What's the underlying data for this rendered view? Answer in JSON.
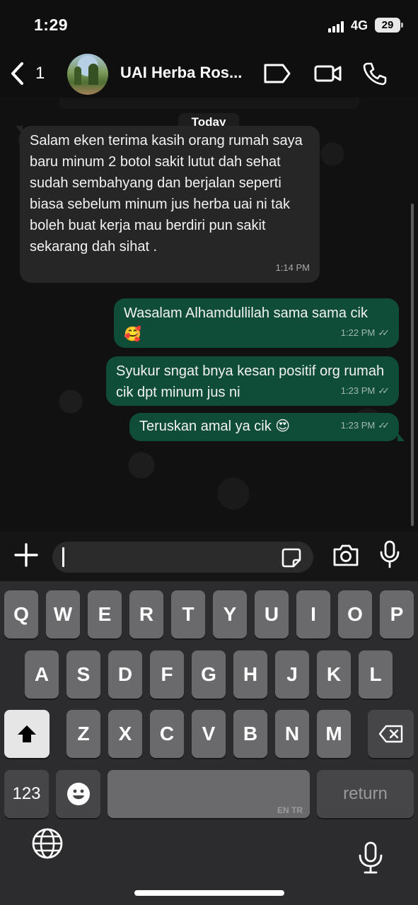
{
  "status_bar": {
    "time": "1:29",
    "network": "4G",
    "battery": "29"
  },
  "header": {
    "back_count": "1",
    "chat_name": "UAI Herba Ros...",
    "icons": [
      "chevron-left-icon",
      "tag-icon",
      "video-call-icon",
      "phone-icon"
    ]
  },
  "chat": {
    "date_label": "Today",
    "messages": [
      {
        "direction": "incoming",
        "text": "Salam eken terima kasih orang rumah saya baru minum 2 botol sakit lutut dah sehat sudah sembahyang dan berjalan seperti biasa sebelum minum jus herba uai ni tak boleh buat kerja mau berdiri pun sakit sekarang dah sihat .",
        "time": "1:14 PM"
      },
      {
        "direction": "outgoing",
        "text": "Wasalam Alhamdullilah sama sama cik 🥰",
        "time": "1:22 PM",
        "status": "read"
      },
      {
        "direction": "outgoing",
        "text": "Syukur sngat bnya kesan positif org rumah cik dpt minum jus ni",
        "time": "1:23 PM",
        "status": "read"
      },
      {
        "direction": "outgoing",
        "text": "Teruskan amal ya cik 😍",
        "time": "1:23 PM",
        "status": "read"
      }
    ]
  },
  "composer": {
    "input_value": ""
  },
  "keyboard": {
    "row1": [
      "Q",
      "W",
      "E",
      "R",
      "T",
      "Y",
      "U",
      "I",
      "O",
      "P"
    ],
    "row2": [
      "A",
      "S",
      "D",
      "F",
      "G",
      "H",
      "J",
      "K",
      "L"
    ],
    "row3": [
      "Z",
      "X",
      "C",
      "V",
      "B",
      "N",
      "M"
    ],
    "numbers_key": "123",
    "space_sub": "EN TR",
    "return_key": "return"
  },
  "colors": {
    "outgoing_bubble": "#0f4d38",
    "incoming_bubble": "#262626",
    "keyboard_bg": "#2c2c2e"
  }
}
